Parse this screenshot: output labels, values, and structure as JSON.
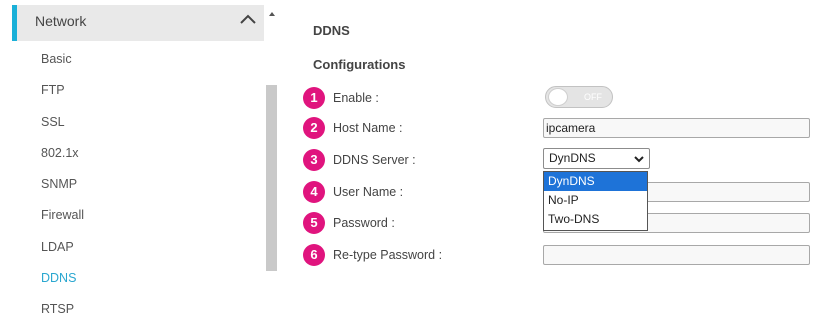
{
  "sidebar": {
    "header_label": "Network",
    "items": [
      {
        "label": "Basic"
      },
      {
        "label": "FTP"
      },
      {
        "label": "SSL"
      },
      {
        "label": "802.1x"
      },
      {
        "label": "SNMP"
      },
      {
        "label": "Firewall"
      },
      {
        "label": "LDAP"
      },
      {
        "label": "DDNS",
        "active": true
      },
      {
        "label": "RTSP"
      }
    ]
  },
  "main": {
    "title": "DDNS",
    "subtitle": "Configurations",
    "badges": [
      "1",
      "2",
      "3",
      "4",
      "5",
      "6"
    ],
    "enable": {
      "label": "Enable :",
      "toggle_text": "OFF",
      "state": "off"
    },
    "host_name": {
      "label": "Host Name :",
      "value": "ipcamera"
    },
    "ddns_server": {
      "label": "DDNS Server :",
      "value": "DynDNS",
      "options": [
        "DynDNS",
        "No-IP",
        "Two-DNS"
      ]
    },
    "user_name": {
      "label": "User Name :",
      "value": ""
    },
    "password": {
      "label": "Password :",
      "value": ""
    },
    "retype_password": {
      "label": "Re-type Password :",
      "value": ""
    }
  },
  "colors": {
    "accent": "#1ab0d8",
    "badge": "#e0147e",
    "selection": "#1e73d8",
    "active_nav": "#2aa7d0"
  }
}
